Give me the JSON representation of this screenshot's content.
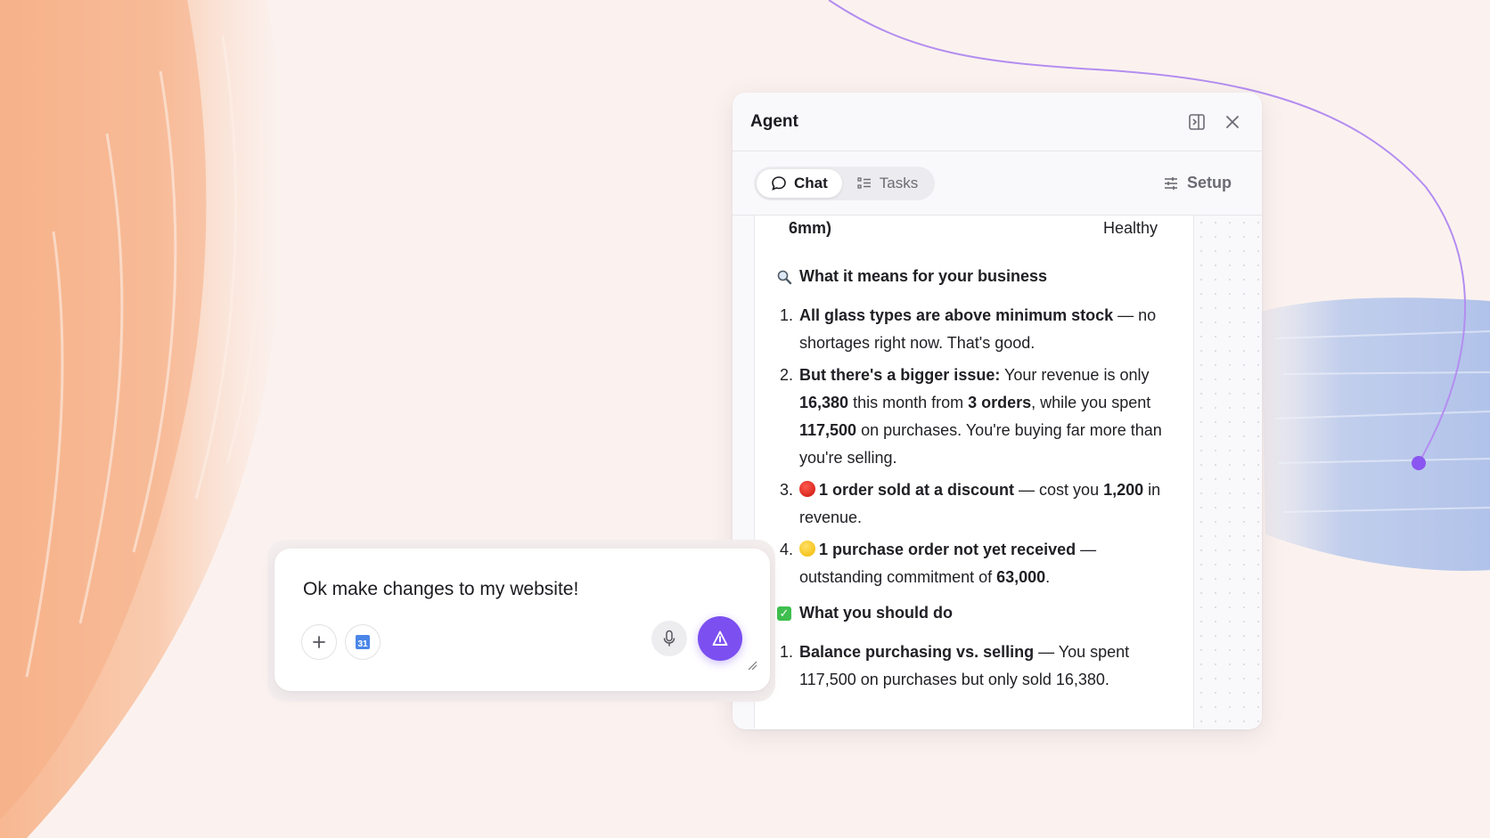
{
  "agent": {
    "title": "Agent",
    "tabs": [
      {
        "label": "Chat",
        "icon": "chat-bubble-icon",
        "active": true
      },
      {
        "label": "Tasks",
        "icon": "checklist-icon",
        "active": false
      }
    ],
    "setup_label": "Setup"
  },
  "message": {
    "table_row": {
      "col1": "6mm)",
      "col2": "Healthy"
    },
    "section1": {
      "icon": "magnifier-icon",
      "heading": "What it means for your business",
      "items": [
        {
          "number": "1.",
          "bold": "All glass types are above minimum stock",
          "rest": " — no shortages right now. That's good."
        },
        {
          "number": "2.",
          "bold": "But there's a bigger issue:",
          "t1": " Your revenue is only ",
          "b1": "16,380",
          "t2": " this month from ",
          "b2": "3 orders",
          "t3": ", while you spent ",
          "b3": "117,500",
          "t4": " on purchases. You're buying far more than you're selling."
        },
        {
          "number": "3.",
          "icon": "red-circle-icon",
          "bold": "1 order sold at a discount",
          "t1": " — cost you ",
          "b1": "1,200",
          "t2": " in revenue."
        },
        {
          "number": "4.",
          "icon": "yellow-circle-icon",
          "bold": "1 purchase order not yet received",
          "t1": " — outstanding commitment of ",
          "b1": "63,000",
          "t2": "."
        }
      ]
    },
    "section2": {
      "icon": "check-box-icon",
      "heading": "What you should do",
      "items": [
        {
          "number": "1.",
          "bold": "Balance purchasing vs. selling",
          "rest": " — You spent 117,500 on purchases but only sold 16,380."
        }
      ]
    }
  },
  "composer": {
    "text": "Ok make changes to my website!",
    "calendar_day": "31"
  },
  "colors": {
    "accent": "#7b4ff0",
    "background": "#fbf2ef",
    "brush_orange": "#f9c6a4",
    "brush_blue": "#b9c9ec"
  }
}
